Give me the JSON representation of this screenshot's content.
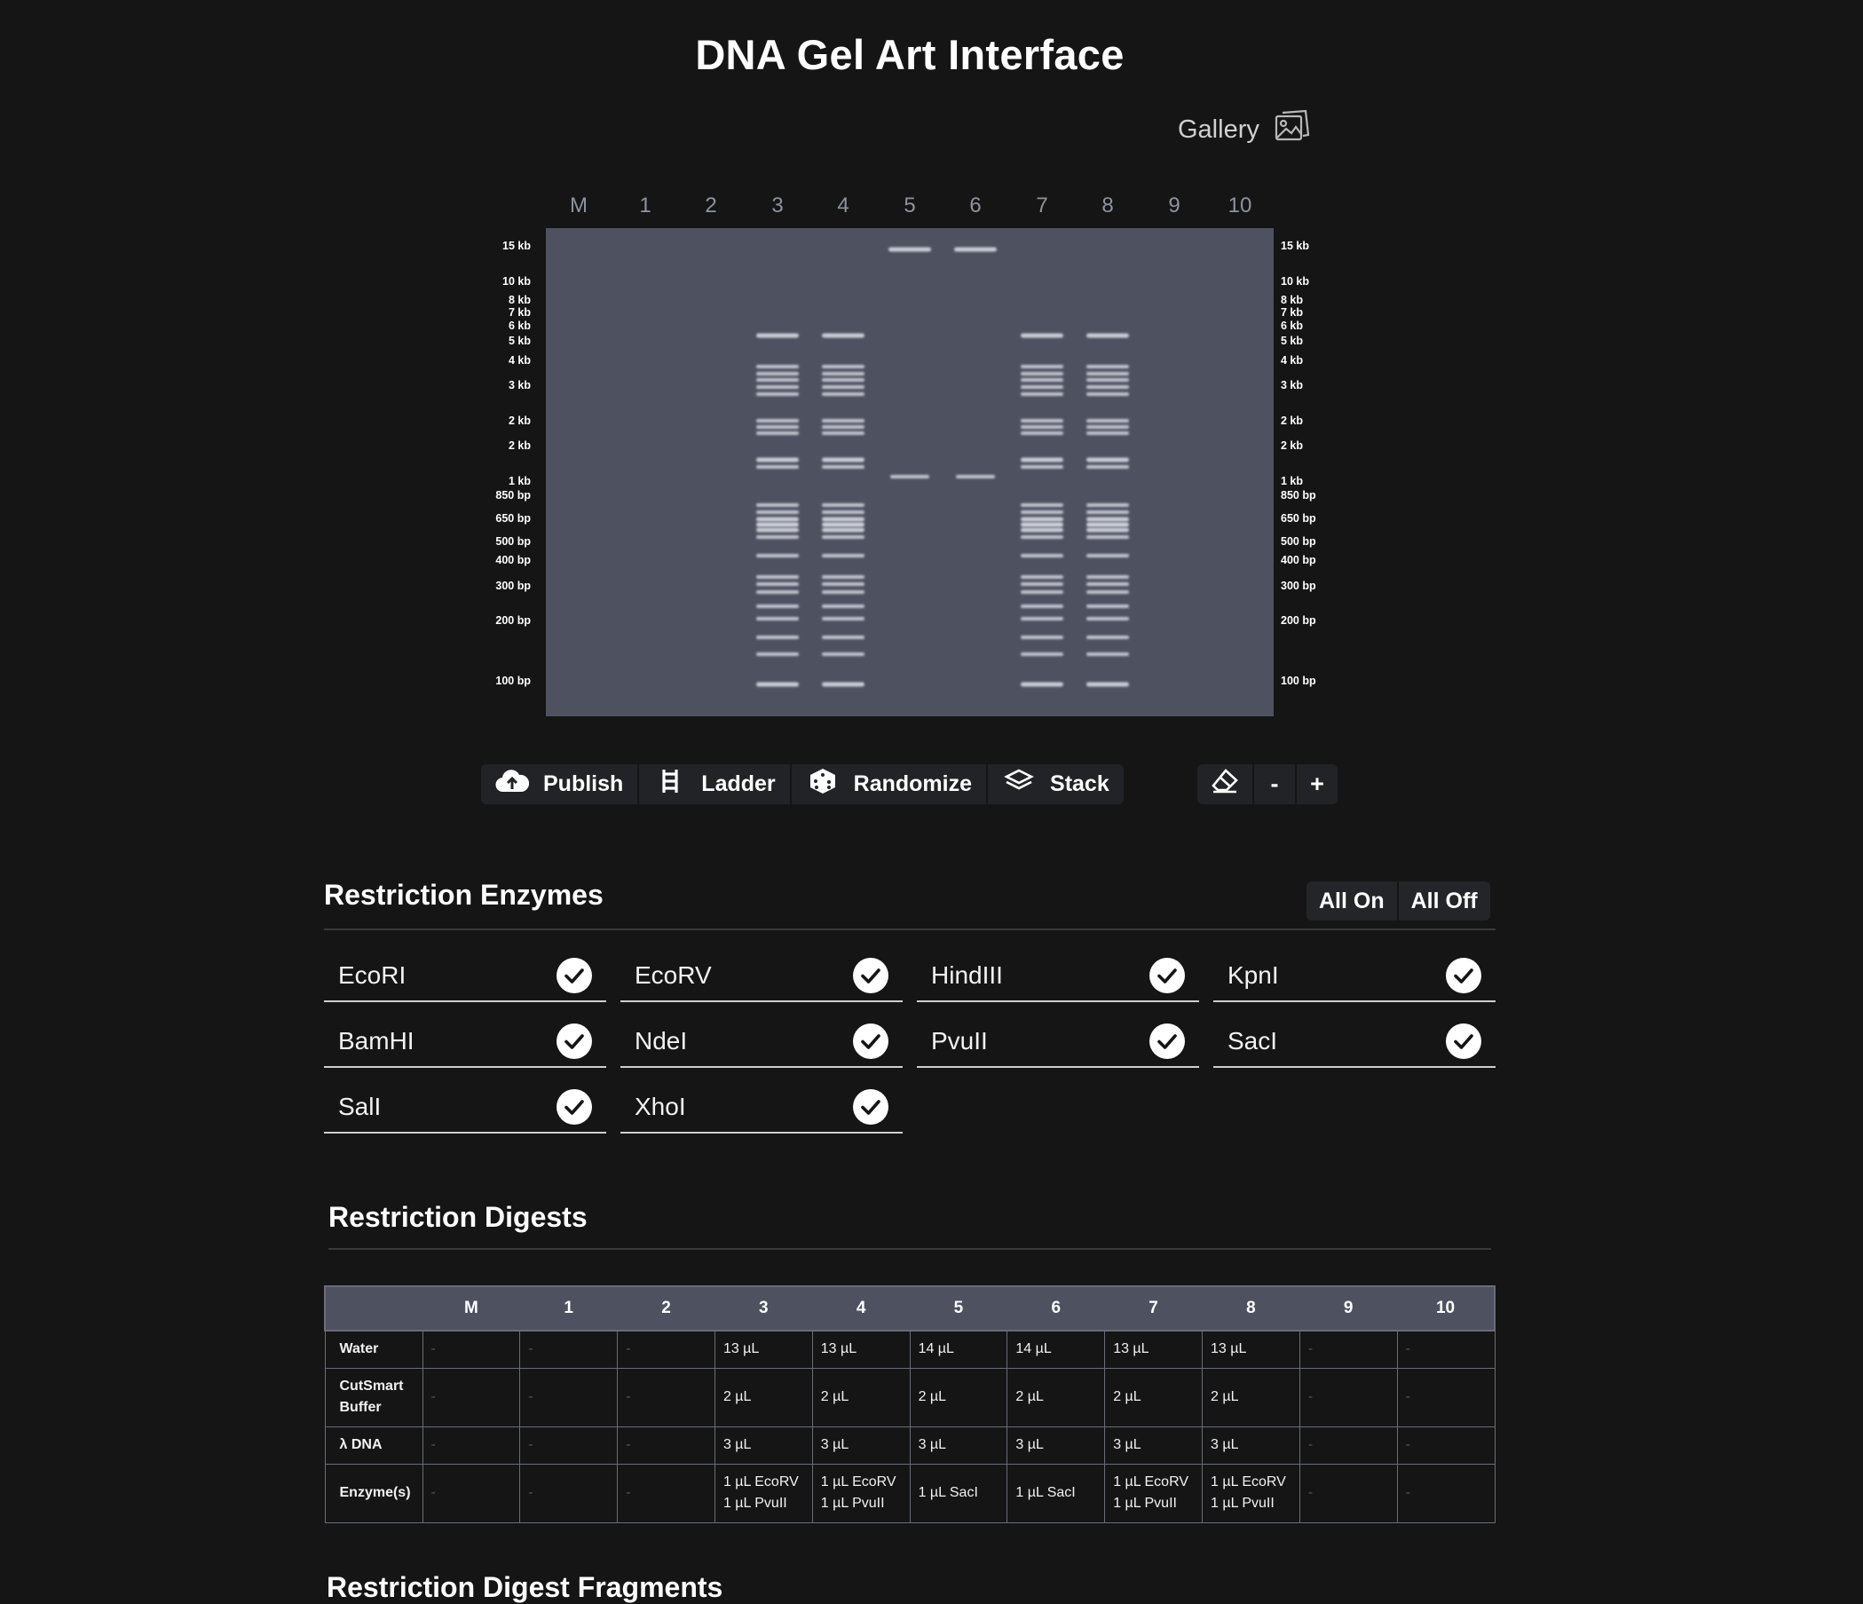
{
  "page": {
    "title": "DNA Gel Art Interface",
    "gallery_label": "Gallery"
  },
  "gel": {
    "lanes": [
      "M",
      "1",
      "2",
      "3",
      "4",
      "5",
      "6",
      "7",
      "8",
      "9",
      "10"
    ],
    "size_labels": [
      "15 kb",
      "10 kb",
      "8 kb",
      "7 kb",
      "6 kb",
      "5 kb",
      "4 kb",
      "3 kb",
      "2 kb",
      "2 kb",
      "1 kb",
      "850 bp",
      "650 bp",
      "500 bp",
      "400 bp",
      "300 bp",
      "200 bp",
      "100 bp"
    ],
    "background_color": "#4d5160",
    "band_color": "#dfe2ea"
  },
  "toolbar": {
    "publish": "Publish",
    "ladder": "Ladder",
    "randomize": "Randomize",
    "stack": "Stack",
    "minus": "-",
    "plus": "+"
  },
  "enzymes_section": {
    "title": "Restriction Enzymes",
    "all_on": "All On",
    "all_off": "All Off",
    "items": [
      {
        "name": "EcoRI",
        "checked": true
      },
      {
        "name": "EcoRV",
        "checked": true
      },
      {
        "name": "HindIII",
        "checked": true
      },
      {
        "name": "KpnI",
        "checked": true
      },
      {
        "name": "BamHI",
        "checked": true
      },
      {
        "name": "NdeI",
        "checked": true
      },
      {
        "name": "PvuII",
        "checked": true
      },
      {
        "name": "SacI",
        "checked": true
      },
      {
        "name": "SalI",
        "checked": true
      },
      {
        "name": "XhoI",
        "checked": true
      }
    ]
  },
  "digests": {
    "title": "Restriction Digests",
    "columns": [
      "M",
      "1",
      "2",
      "3",
      "4",
      "5",
      "6",
      "7",
      "8",
      "9",
      "10"
    ],
    "rows": [
      {
        "label": "Water",
        "cells": [
          "-",
          "-",
          "-",
          "13 µL",
          "13 µL",
          "14 µL",
          "14 µL",
          "13 µL",
          "13 µL",
          "-",
          "-"
        ]
      },
      {
        "label": "CutSmart Buffer",
        "cells": [
          "-",
          "-",
          "-",
          "2 µL",
          "2 µL",
          "2 µL",
          "2 µL",
          "2 µL",
          "2 µL",
          "-",
          "-"
        ]
      },
      {
        "label": "λ DNA",
        "cells": [
          "-",
          "-",
          "-",
          "3 µL",
          "3 µL",
          "3 µL",
          "3 µL",
          "3 µL",
          "3 µL",
          "-",
          "-"
        ]
      },
      {
        "label": "Enzyme(s)",
        "cells": [
          "-",
          "-",
          "-",
          "1 µL EcoRV\n1 µL PvuII",
          "1 µL EcoRV\n1 µL PvuII",
          "1 µL SacI",
          "1 µL SacI",
          "1 µL EcoRV\n1 µL PvuII",
          "1 µL EcoRV\n1 µL PvuII",
          "-",
          "-"
        ]
      }
    ]
  },
  "cut_section": {
    "title": "Restriction Digest Fragments"
  }
}
